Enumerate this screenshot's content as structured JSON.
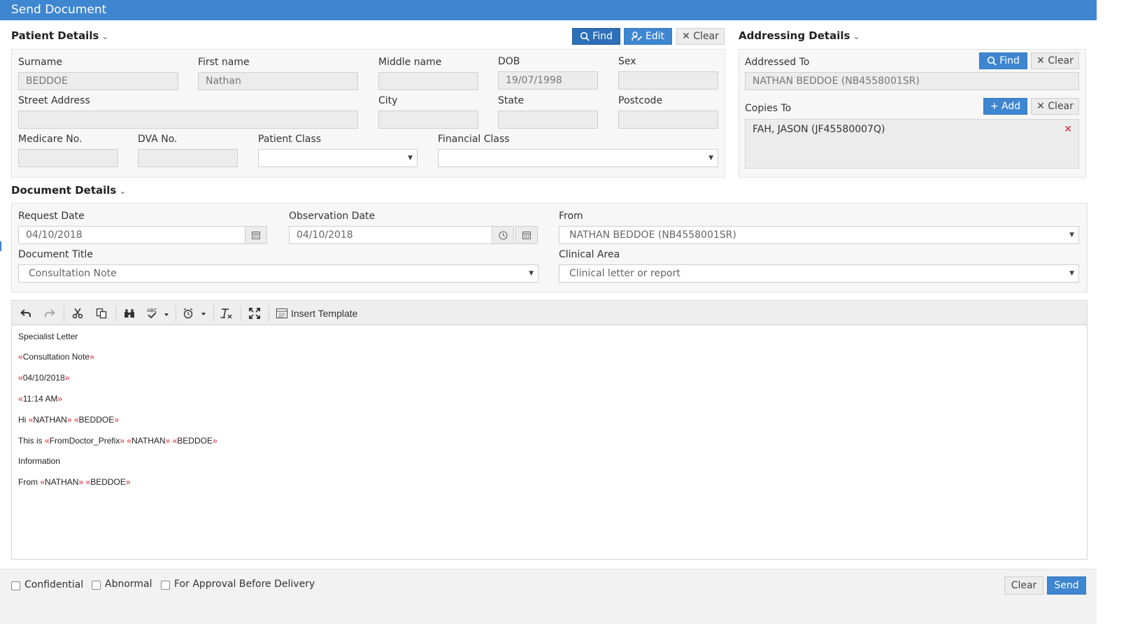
{
  "window": {
    "title": "Send Document"
  },
  "patient": {
    "section_title": "Patient Details",
    "find_label": "Find",
    "edit_label": "Edit",
    "clear_label": "Clear",
    "labels": {
      "surname": "Surname",
      "first_name": "First name",
      "middle_name": "Middle name",
      "dob": "DOB",
      "sex": "Sex",
      "street": "Street Address",
      "city": "City",
      "state": "State",
      "postcode": "Postcode",
      "medicare": "Medicare No.",
      "dva": "DVA No.",
      "patient_class": "Patient Class",
      "financial_class": "Financial Class"
    },
    "values": {
      "surname": "BEDDOE",
      "first_name": "Nathan",
      "middle_name": "",
      "dob": "19/07/1998",
      "sex": "",
      "street": "",
      "city": "",
      "state": "",
      "postcode": "",
      "medicare": "",
      "dva": "",
      "patient_class": "",
      "financial_class": ""
    }
  },
  "addressing": {
    "section_title": "Addressing Details",
    "addressed_to_label": "Addressed To",
    "find_label": "Find",
    "clear_label": "Clear",
    "addressed_to_value": "NATHAN BEDDOE (NB4558001SR)",
    "copies_to_label": "Copies To",
    "add_label": "Add",
    "copies": [
      "FAH, JASON (JF45580007Q)"
    ]
  },
  "document": {
    "section_title": "Document Details",
    "request_date_label": "Request Date",
    "request_date": "04/10/2018",
    "observation_date_label": "Observation Date",
    "observation_date": "04/10/2018",
    "from_label": "From",
    "from_value": "NATHAN BEDDOE (NB4558001SR)",
    "title_label": "Document Title",
    "title_value": "Consultation Note",
    "clinical_area_label": "Clinical Area",
    "clinical_area_value": "Clinical letter or report"
  },
  "toolbar": {
    "insert_template_label": "Insert Template"
  },
  "editor": {
    "l1": "Specialist Letter",
    "l2": "Consultation Note",
    "l3": "04/10/2018",
    "l4": "11:14 AM",
    "hi": "Hi",
    "first": "NATHAN",
    "last": "BEDDOE",
    "this_is": "This is",
    "prefix": "FromDoctor_Prefix",
    "information": "Information",
    "from": "From",
    "open_mark": "«",
    "close_mark": "»"
  },
  "footer": {
    "confidential_label": "Confidential",
    "abnormal_label": "Abnormal",
    "approval_label": "For Approval Before Delivery",
    "clear_label": "Clear",
    "send_label": "Send"
  },
  "colors": {
    "primary": "#3e86d0",
    "primary_dark": "#2d6fb8",
    "merge_marker": "#d9232e"
  }
}
